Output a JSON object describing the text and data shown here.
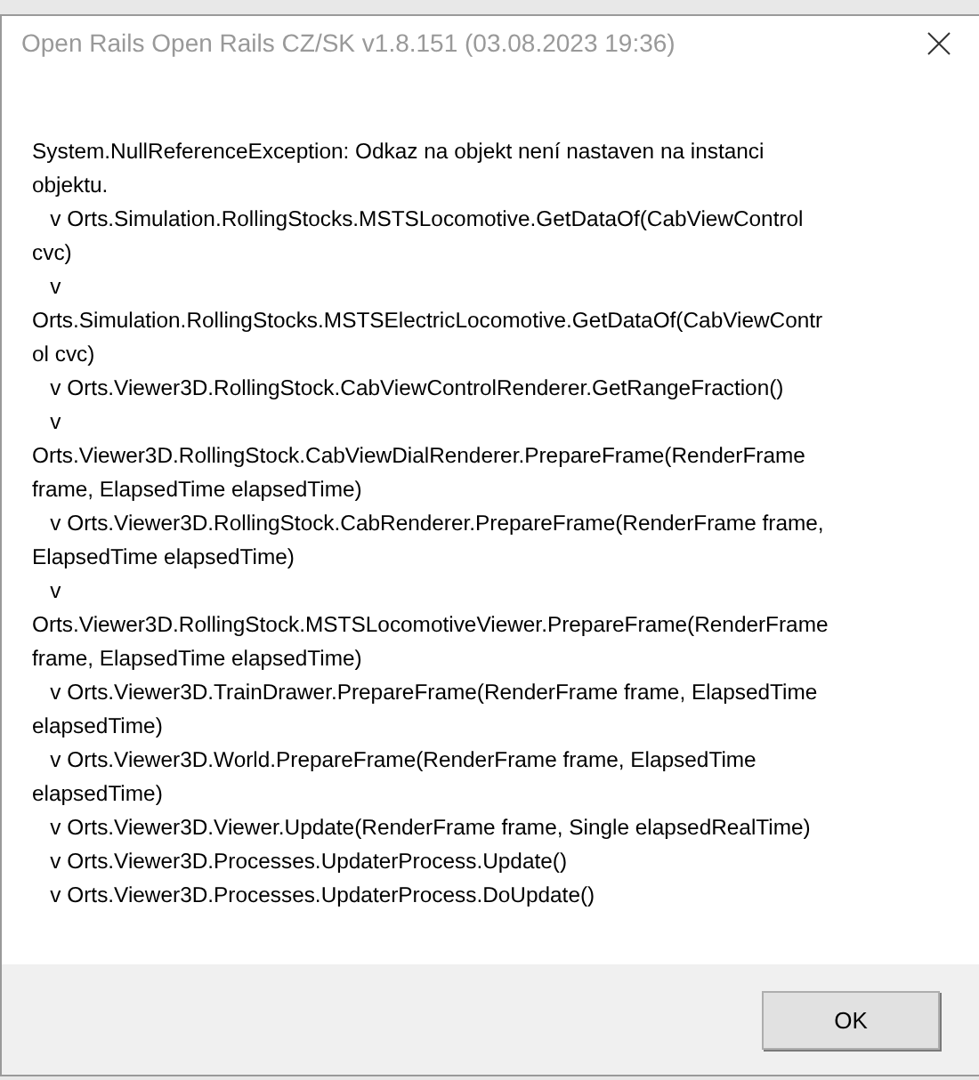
{
  "window": {
    "title": "Open Rails Open Rails CZ/SK v1.8.151 (03.08.2023 19:36)"
  },
  "message_lines": [
    "System.NullReferenceException: Odkaz na objekt není nastaven na instanci",
    "objektu.",
    "   v Orts.Simulation.RollingStocks.MSTSLocomotive.GetDataOf(CabViewControl",
    "cvc)",
    "   v",
    "Orts.Simulation.RollingStocks.MSTSElectricLocomotive.GetDataOf(CabViewContr",
    "ol cvc)",
    "   v Orts.Viewer3D.RollingStock.CabViewControlRenderer.GetRangeFraction()",
    "   v",
    "Orts.Viewer3D.RollingStock.CabViewDialRenderer.PrepareFrame(RenderFrame",
    "frame, ElapsedTime elapsedTime)",
    "   v Orts.Viewer3D.RollingStock.CabRenderer.PrepareFrame(RenderFrame frame,",
    "ElapsedTime elapsedTime)",
    "   v",
    "Orts.Viewer3D.RollingStock.MSTSLocomotiveViewer.PrepareFrame(RenderFrame",
    "frame, ElapsedTime elapsedTime)",
    "   v Orts.Viewer3D.TrainDrawer.PrepareFrame(RenderFrame frame, ElapsedTime",
    "elapsedTime)",
    "   v Orts.Viewer3D.World.PrepareFrame(RenderFrame frame, ElapsedTime",
    "elapsedTime)",
    "   v Orts.Viewer3D.Viewer.Update(RenderFrame frame, Single elapsedRealTime)",
    "   v Orts.Viewer3D.Processes.UpdaterProcess.Update()",
    "   v Orts.Viewer3D.Processes.UpdaterProcess.DoUpdate()"
  ],
  "buttons": [
    "OK"
  ]
}
